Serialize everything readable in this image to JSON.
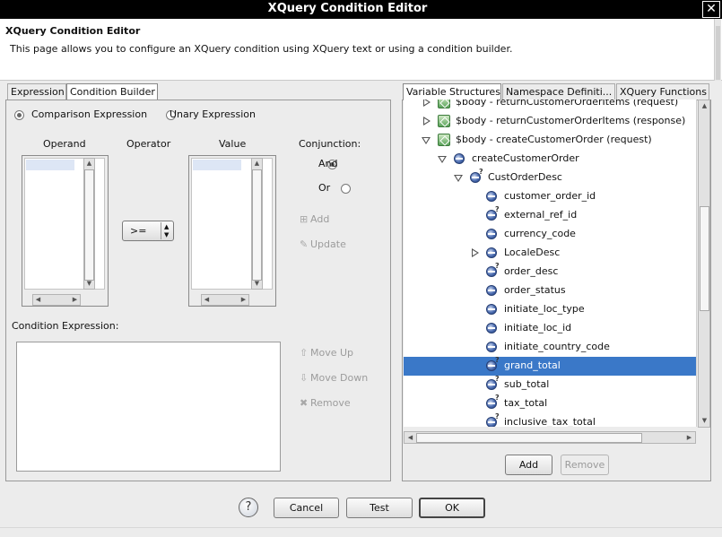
{
  "window": {
    "title": "XQuery Condition Editor"
  },
  "header": {
    "title": "XQuery Condition Editor",
    "description": "This page allows you to configure an XQuery condition using XQuery text or using a condition builder."
  },
  "left_tabs": [
    {
      "label": "Expression",
      "active": false
    },
    {
      "label": "Condition Builder",
      "active": true
    }
  ],
  "builder": {
    "type_options": [
      {
        "label": "Comparison Expression",
        "selected": true
      },
      {
        "label": "Unary Expression",
        "selected": false
      }
    ],
    "operand_label": "Operand",
    "operator_label": "Operator",
    "operator_value": ">=",
    "value_label": "Value",
    "conjunction_label": "Conjunction:",
    "conjunction_options": [
      {
        "label": "And",
        "selected": true
      },
      {
        "label": "Or",
        "selected": false
      }
    ],
    "add_label": "Add",
    "update_label": "Update",
    "condition_expression_label": "Condition Expression:",
    "condition_expression_value": "",
    "move_up_label": "Move Up",
    "move_down_label": "Move Down",
    "remove_label": "Remove"
  },
  "right_tabs": [
    {
      "label": "Variable Structures",
      "active": true
    },
    {
      "label": "Namespace Definiti...",
      "active": false
    },
    {
      "label": "XQuery Functions",
      "active": false
    }
  ],
  "tree": [
    {
      "label": "$body - returnCustomerOrderItems (request)",
      "icon": "variable-icon",
      "twisty": "closed",
      "depth": 0
    },
    {
      "label": "$body - returnCustomerOrderItems (response)",
      "icon": "variable-icon",
      "twisty": "closed",
      "depth": 0
    },
    {
      "label": "$body - createCustomerOrder (request)",
      "icon": "variable-icon",
      "twisty": "open",
      "depth": 0
    },
    {
      "label": "createCustomerOrder",
      "icon": "element-icon",
      "twisty": "open",
      "depth": 1
    },
    {
      "label": "CustOrderDesc",
      "icon": "optional-element-icon",
      "twisty": "open",
      "depth": 2
    },
    {
      "label": "customer_order_id",
      "icon": "element-icon",
      "twisty": "none",
      "depth": 3
    },
    {
      "label": "external_ref_id",
      "icon": "optional-element-icon",
      "twisty": "none",
      "depth": 3
    },
    {
      "label": "currency_code",
      "icon": "element-icon",
      "twisty": "none",
      "depth": 3
    },
    {
      "label": "LocaleDesc",
      "icon": "element-icon",
      "twisty": "closed",
      "depth": 3
    },
    {
      "label": "order_desc",
      "icon": "optional-element-icon",
      "twisty": "none",
      "depth": 3
    },
    {
      "label": "order_status",
      "icon": "element-icon",
      "twisty": "none",
      "depth": 3
    },
    {
      "label": "initiate_loc_type",
      "icon": "element-icon",
      "twisty": "none",
      "depth": 3
    },
    {
      "label": "initiate_loc_id",
      "icon": "element-icon",
      "twisty": "none",
      "depth": 3
    },
    {
      "label": "initiate_country_code",
      "icon": "element-icon",
      "twisty": "none",
      "depth": 3
    },
    {
      "label": "grand_total",
      "icon": "optional-element-icon",
      "twisty": "none",
      "depth": 3,
      "selected": true
    },
    {
      "label": "sub_total",
      "icon": "optional-element-icon",
      "twisty": "none",
      "depth": 3
    },
    {
      "label": "tax_total",
      "icon": "optional-element-icon",
      "twisty": "none",
      "depth": 3
    },
    {
      "label": "inclusive_tax_total",
      "icon": "optional-element-icon",
      "twisty": "none",
      "depth": 3
    }
  ],
  "tree_buttons": {
    "add": "Add",
    "remove": "Remove"
  },
  "footer": {
    "cancel": "Cancel",
    "test": "Test",
    "ok": "OK"
  }
}
